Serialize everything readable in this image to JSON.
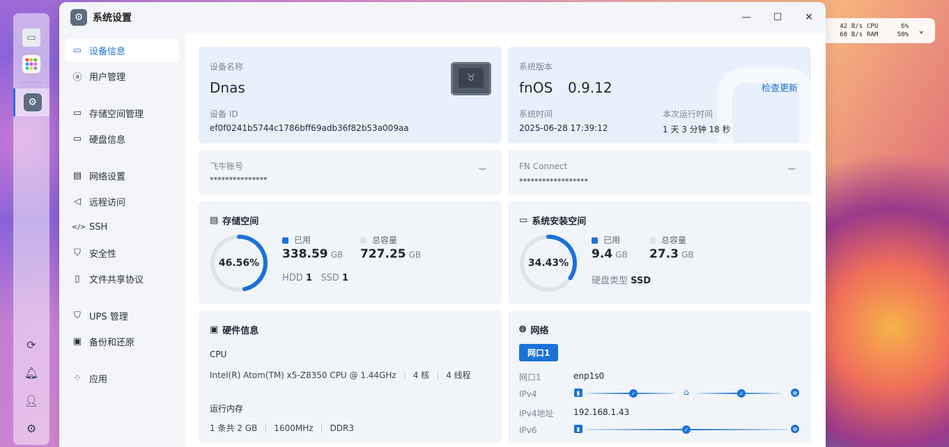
{
  "status_widget": {
    "net_up": "42",
    "net_up_unit": "B/s",
    "cpu_label": "CPU",
    "cpu_value": "6%",
    "net_down": "60",
    "net_down_unit": "B/s",
    "ram_label": "RAM",
    "ram_value": "50%"
  },
  "window": {
    "title": "系统设置"
  },
  "nav": {
    "items": [
      {
        "label": "设备信息",
        "icon": "monitor-icon"
      },
      {
        "label": "用户管理",
        "icon": "user-icon"
      },
      {
        "label": "存储空间管理",
        "icon": "storage-icon"
      },
      {
        "label": "硬盘信息",
        "icon": "disk-icon"
      },
      {
        "label": "网络设置",
        "icon": "network-icon"
      },
      {
        "label": "远程访问",
        "icon": "send-icon"
      },
      {
        "label": "SSH",
        "icon": "code-icon"
      },
      {
        "label": "安全性",
        "icon": "shield-icon"
      },
      {
        "label": "文件共享协议",
        "icon": "file-icon"
      },
      {
        "label": "UPS 管理",
        "icon": "shield-outline-icon"
      },
      {
        "label": "备份和还原",
        "icon": "backup-icon"
      },
      {
        "label": "应用",
        "icon": "apps-icon"
      }
    ]
  },
  "device": {
    "name_label": "设备名称",
    "name": "Dnas",
    "id_label": "设备 ID",
    "id": "ef0f0241b5744c1786bff69adb36f82b53a009aa"
  },
  "system": {
    "version_label": "系统版本",
    "os": "fnOS",
    "version": "0.9.12",
    "check_update": "检查更新",
    "time_label": "系统时间",
    "time": "2025-06-28 17:39:12",
    "uptime_label": "本次运行时间",
    "uptime": "1 天 3 分钟 18 秒"
  },
  "account": {
    "label": "飞牛账号",
    "value": "***************"
  },
  "connect": {
    "label": "FN Connect",
    "value": "******************"
  },
  "storage": {
    "title": "存储空间",
    "percent": 46.56,
    "percent_text": "46.56%",
    "used_label": "已用",
    "used": "338.59",
    "used_unit": "GB",
    "total_label": "总容量",
    "total": "727.25",
    "total_unit": "GB",
    "hdd_label": "HDD",
    "hdd": "1",
    "ssd_label": "SSD",
    "ssd": "1"
  },
  "sys_storage": {
    "title": "系统安装空间",
    "percent": 34.43,
    "percent_text": "34.43%",
    "used_label": "已用",
    "used": "9.4",
    "used_unit": "GB",
    "total_label": "总容量",
    "total": "27.3",
    "total_unit": "GB",
    "disk_type_label": "硬盘类型",
    "disk_type": "SSD"
  },
  "hardware": {
    "title": "硬件信息",
    "cpu_label": "CPU",
    "cpu": "Intel(R) Atom(TM) x5-Z8350 CPU @ 1.44GHz",
    "cores": "4 核",
    "threads": "4 线程",
    "mem_label": "运行内存",
    "mem_count": "1 条共 2 GB",
    "mem_freq": "1600MHz",
    "mem_type": "DDR3"
  },
  "network": {
    "title": "网络",
    "tab": "网口1",
    "port_label": "网口1",
    "port": "enp1s0",
    "ipv4_label": "IPv4",
    "ipv4_addr_label": "IPv4地址",
    "ipv4_addr": "192.168.1.43",
    "ipv6_label": "IPv6"
  },
  "colors": {
    "accent": "#1b72d6",
    "gauge_track": "#dfe4ea"
  }
}
